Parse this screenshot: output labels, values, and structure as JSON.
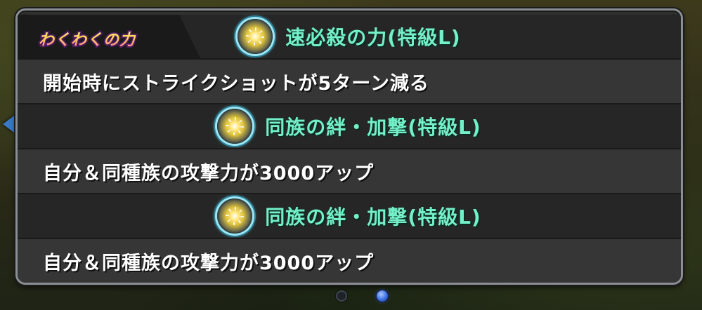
{
  "header": {
    "tag_label": "わくわくの力"
  },
  "abilities": [
    {
      "name": "速必殺の力(特級L)",
      "icon": "sparkle-orb-icon",
      "description": "開始時にストライクショットが5ターン減る"
    },
    {
      "name": "同族の絆・加撃(特級L)",
      "icon": "sparkle-orb-icon",
      "description": "自分＆同種族の攻撃力が3000アップ"
    },
    {
      "name": "同族の絆・加撃(特級L)",
      "icon": "sparkle-orb-icon",
      "description": "自分＆同種族の攻撃力が3000アップ"
    }
  ],
  "pager": {
    "pages": 2,
    "current": 2
  },
  "colors": {
    "ability_name": "#73f0c8",
    "panel_bg": "#30302f",
    "panel_border": "#8b8e92",
    "active_dot": "#3a6fe2"
  }
}
